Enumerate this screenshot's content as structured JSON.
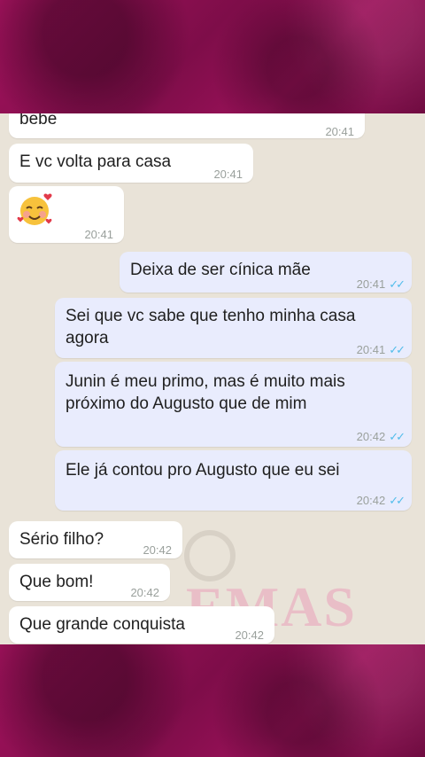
{
  "messages": [
    {
      "dir": "in",
      "text": "bebe",
      "time": "20:41"
    },
    {
      "dir": "in",
      "text": "E vc volta para casa",
      "time": "20:41"
    },
    {
      "dir": "in",
      "emoji": "smiling-face-with-hearts-icon",
      "time": "20:41"
    },
    {
      "dir": "out",
      "text": "Deixa de ser cínica mãe",
      "time": "20:41",
      "status": "read"
    },
    {
      "dir": "out",
      "lines": [
        "Sei que vc sabe que tenho minha casa",
        "agora"
      ],
      "time": "20:41",
      "status": "read"
    },
    {
      "dir": "out",
      "lines": [
        "Junin é meu primo, mas é muito mais",
        "próximo do Augusto que de mim"
      ],
      "time": "20:42",
      "status": "read"
    },
    {
      "dir": "out",
      "text": "Ele já contou pro Augusto que eu sei",
      "time": "20:42",
      "status": "read"
    },
    {
      "dir": "in",
      "text": "Sério filho?",
      "time": "20:42"
    },
    {
      "dir": "in",
      "text": "Que bom!",
      "time": "20:42"
    },
    {
      "dir": "in",
      "text": "Que grande conquista",
      "time": "20:42"
    }
  ],
  "watermark": {
    "text": "EMAS"
  },
  "colors": {
    "frame": "#8e0f52",
    "chat_bg": "#e9e3d8",
    "incoming": "#ffffff",
    "outgoing": "#e9ecfd",
    "ticks": "#53bdeb"
  }
}
